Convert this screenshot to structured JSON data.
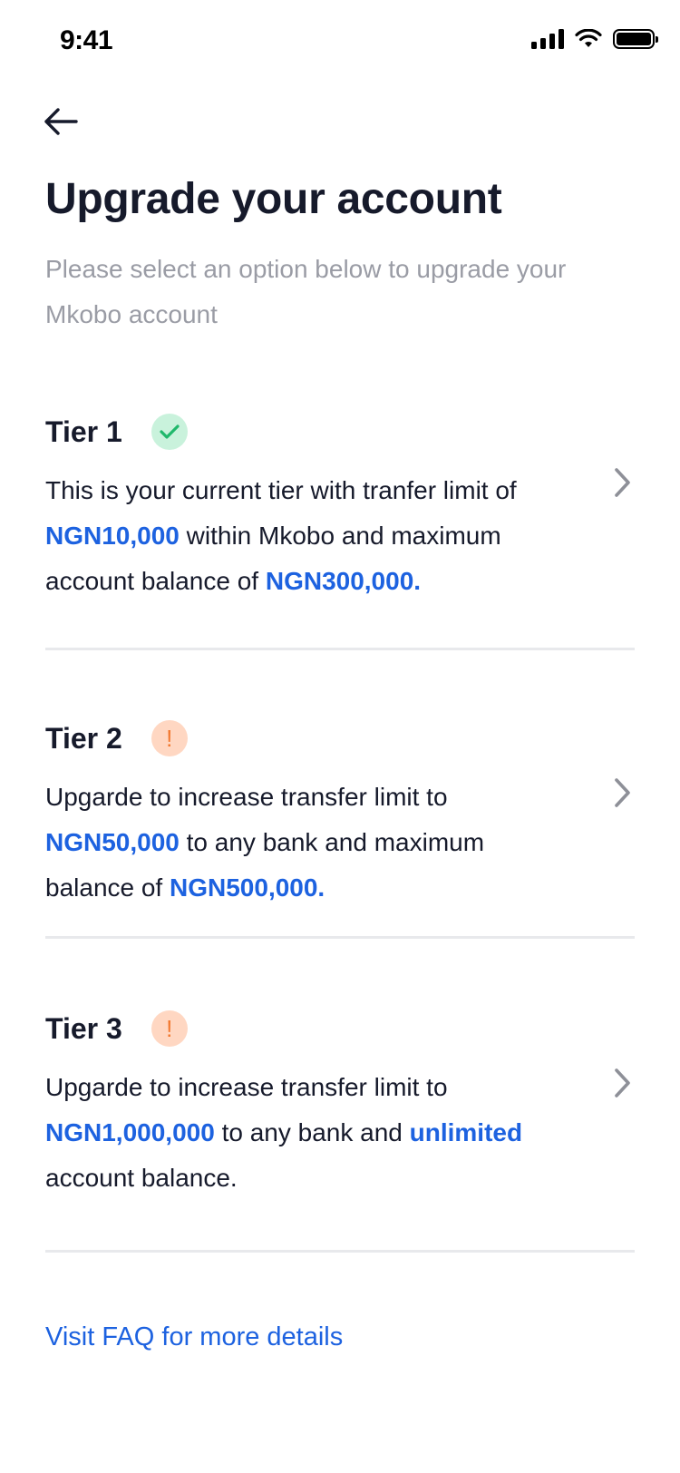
{
  "status_bar": {
    "time": "9:41"
  },
  "header": {
    "title": "Upgrade your account",
    "subtitle": "Please select an option below to upgrade your Mkobo account"
  },
  "tiers": [
    {
      "title": "Tier 1",
      "status_icon": "check-icon",
      "status_glyph": "✓",
      "desc": [
        "This is your current tier with tranfer limit of ",
        "NGN10,000",
        " within Mkobo and maximum account balance of ",
        "NGN300,000."
      ]
    },
    {
      "title": "Tier 2",
      "status_icon": "exclamation-icon",
      "status_glyph": "!",
      "desc": [
        "Upgarde to increase transfer limit to ",
        "NGN50,000",
        " to any bank and maximum balance of ",
        "NGN500,000."
      ]
    },
    {
      "title": "Tier 3",
      "status_icon": "exclamation-icon",
      "status_glyph": "!",
      "desc": [
        "Upgarde to increase transfer limit to ",
        "NGN1,000,000",
        " to any bank and ",
        "unlimited",
        " account balance."
      ]
    }
  ],
  "faq_link": "Visit FAQ for more details",
  "colors": {
    "accent": "#1d62e0",
    "text": "#161a2b",
    "muted": "#9a9ca5",
    "success_bg": "#c9f2dc",
    "success_fg": "#1fb86b",
    "warning_bg": "#ffd7c2",
    "warning_fg": "#f2782f",
    "divider": "#e8e9ec"
  }
}
